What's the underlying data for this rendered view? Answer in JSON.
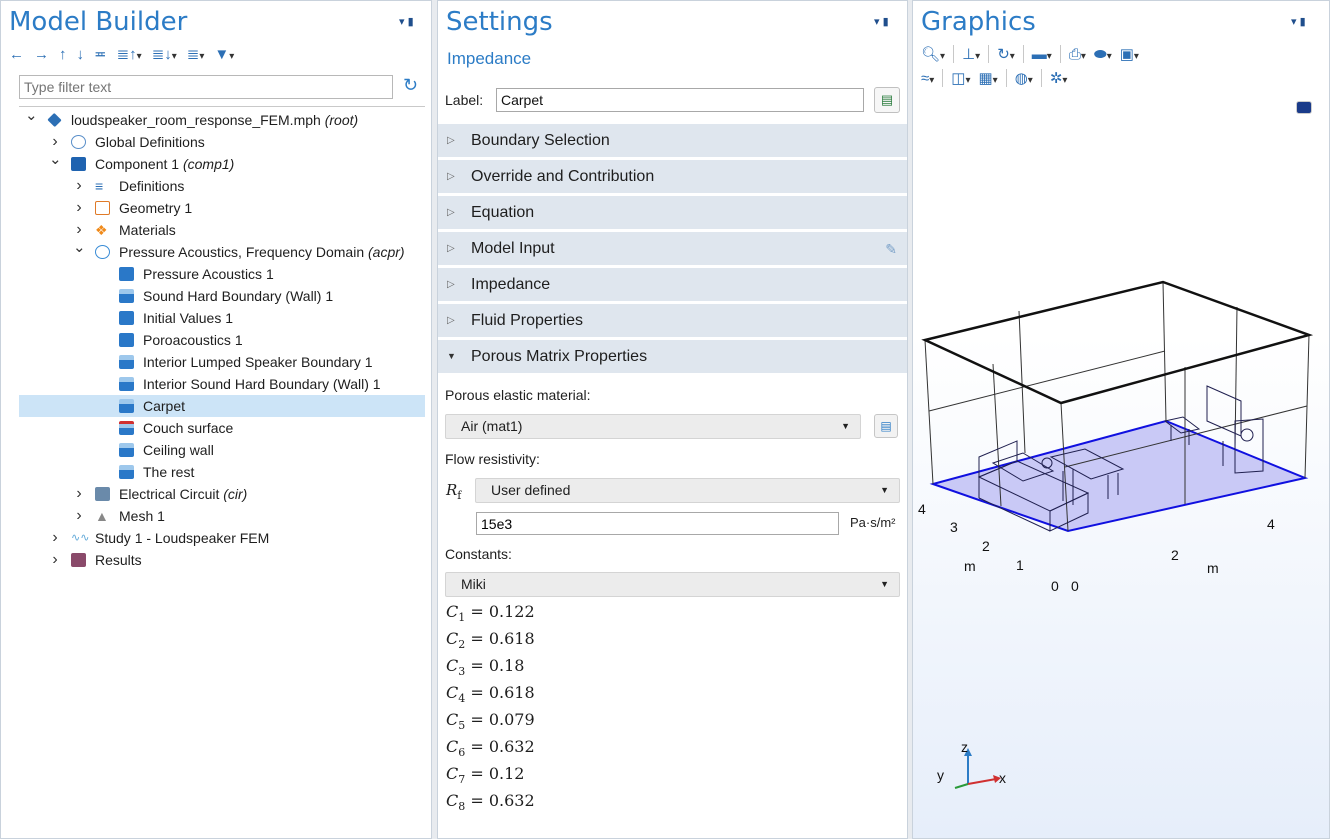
{
  "model_builder": {
    "title": "Model Builder",
    "filter_placeholder": "Type filter text",
    "tree": [
      {
        "indent": 0,
        "exp": "v",
        "icon": "root-file-icon",
        "label": "loudspeaker_room_response_FEM.mph",
        "tag": "(root)",
        "selected": false
      },
      {
        "indent": 1,
        "exp": ">",
        "icon": "globe-icon",
        "label": "Global Definitions",
        "tag": "",
        "selected": false
      },
      {
        "indent": 1,
        "exp": "v",
        "icon": "component-icon",
        "label": "Component 1",
        "tag": "(comp1)",
        "selected": false
      },
      {
        "indent": 2,
        "exp": ">",
        "icon": "definitions-icon",
        "label": "Definitions",
        "tag": "",
        "selected": false
      },
      {
        "indent": 2,
        "exp": ">",
        "icon": "geometry-icon",
        "label": "Geometry 1",
        "tag": "",
        "selected": false
      },
      {
        "indent": 2,
        "exp": ">",
        "icon": "materials-icon",
        "label": "Materials",
        "tag": "",
        "selected": false
      },
      {
        "indent": 2,
        "exp": "v",
        "icon": "acoustics-icon",
        "label": "Pressure Acoustics, Frequency Domain",
        "tag": "(acpr)",
        "selected": false
      },
      {
        "indent": 3,
        "exp": "",
        "icon": "domain-feature-icon",
        "label": "Pressure Acoustics 1",
        "tag": "",
        "selected": false
      },
      {
        "indent": 3,
        "exp": "",
        "icon": "boundary-default-icon",
        "label": "Sound Hard Boundary (Wall) 1",
        "tag": "",
        "selected": false
      },
      {
        "indent": 3,
        "exp": "",
        "icon": "domain-feature-icon",
        "label": "Initial Values 1",
        "tag": "",
        "selected": false
      },
      {
        "indent": 3,
        "exp": "",
        "icon": "domain-icon",
        "label": "Poroacoustics 1",
        "tag": "",
        "selected": false
      },
      {
        "indent": 3,
        "exp": "",
        "icon": "boundary-icon",
        "label": "Interior Lumped Speaker Boundary 1",
        "tag": "",
        "selected": false
      },
      {
        "indent": 3,
        "exp": "",
        "icon": "boundary-icon",
        "label": "Interior Sound Hard Boundary (Wall) 1",
        "tag": "",
        "selected": false
      },
      {
        "indent": 3,
        "exp": "",
        "icon": "boundary-icon",
        "label": "Carpet",
        "tag": "",
        "selected": true
      },
      {
        "indent": 3,
        "exp": "",
        "icon": "boundary-overridden-icon",
        "label": "Couch surface",
        "tag": "",
        "selected": false
      },
      {
        "indent": 3,
        "exp": "",
        "icon": "boundary-icon",
        "label": "Ceiling wall",
        "tag": "",
        "selected": false
      },
      {
        "indent": 3,
        "exp": "",
        "icon": "boundary-icon",
        "label": "The rest",
        "tag": "",
        "selected": false
      },
      {
        "indent": 2,
        "exp": ">",
        "icon": "circuit-icon",
        "label": "Electrical Circuit",
        "tag": "(cir)",
        "selected": false
      },
      {
        "indent": 2,
        "exp": ">",
        "icon": "mesh-icon",
        "label": "Mesh 1",
        "tag": "",
        "selected": false
      },
      {
        "indent": 1,
        "exp": ">",
        "icon": "study-icon",
        "label": "Study 1 - Loudspeaker FEM",
        "tag": "",
        "selected": false
      },
      {
        "indent": 1,
        "exp": ">",
        "icon": "results-icon",
        "label": "Results",
        "tag": "",
        "selected": false
      }
    ]
  },
  "settings": {
    "title": "Settings",
    "subtitle": "Impedance",
    "label_caption": "Label:",
    "label_value": "Carpet",
    "sections": [
      {
        "label": "Boundary Selection",
        "expanded": false
      },
      {
        "label": "Override and Contribution",
        "expanded": false
      },
      {
        "label": "Equation",
        "expanded": false
      },
      {
        "label": "Model Input",
        "expanded": false
      },
      {
        "label": "Impedance",
        "expanded": false
      },
      {
        "label": "Fluid Properties",
        "expanded": false
      },
      {
        "label": "Porous Matrix Properties",
        "expanded": true
      }
    ],
    "porous_caption": "Porous elastic material:",
    "porous_value": "Air (mat1)",
    "flow_caption": "Flow resistivity:",
    "flow_symbol": "R",
    "flow_symbol_sub": "f",
    "flow_mode": "User defined",
    "flow_value": "15e3",
    "flow_unit": "Pa·s/m²",
    "constants_caption": "Constants:",
    "constants_mode": "Miki",
    "constants": [
      {
        "sym": "C",
        "sub": "1",
        "value": "0.122"
      },
      {
        "sym": "C",
        "sub": "2",
        "value": "0.618"
      },
      {
        "sym": "C",
        "sub": "3",
        "value": "0.18"
      },
      {
        "sym": "C",
        "sub": "4",
        "value": "0.618"
      },
      {
        "sym": "C",
        "sub": "5",
        "value": "0.079"
      },
      {
        "sym": "C",
        "sub": "6",
        "value": "0.632"
      },
      {
        "sym": "C",
        "sub": "7",
        "value": "0.12"
      },
      {
        "sym": "C",
        "sub": "8",
        "value": "0.632"
      }
    ]
  },
  "graphics": {
    "title": "Graphics",
    "axis_ticks_left": [
      "4",
      "3",
      "2",
      "1",
      "0"
    ],
    "axis_ticks_bottom": [
      "0",
      "2",
      "4"
    ],
    "axis_unit_left": "m",
    "axis_unit_bottom": "m",
    "triad": {
      "z": "z",
      "y": "y",
      "x": "x"
    }
  },
  "colors": {
    "accent": "#2c7cc6",
    "selection": "#cce4f7",
    "floor": "#c8c8f5",
    "floor_edge": "#1010e0"
  }
}
